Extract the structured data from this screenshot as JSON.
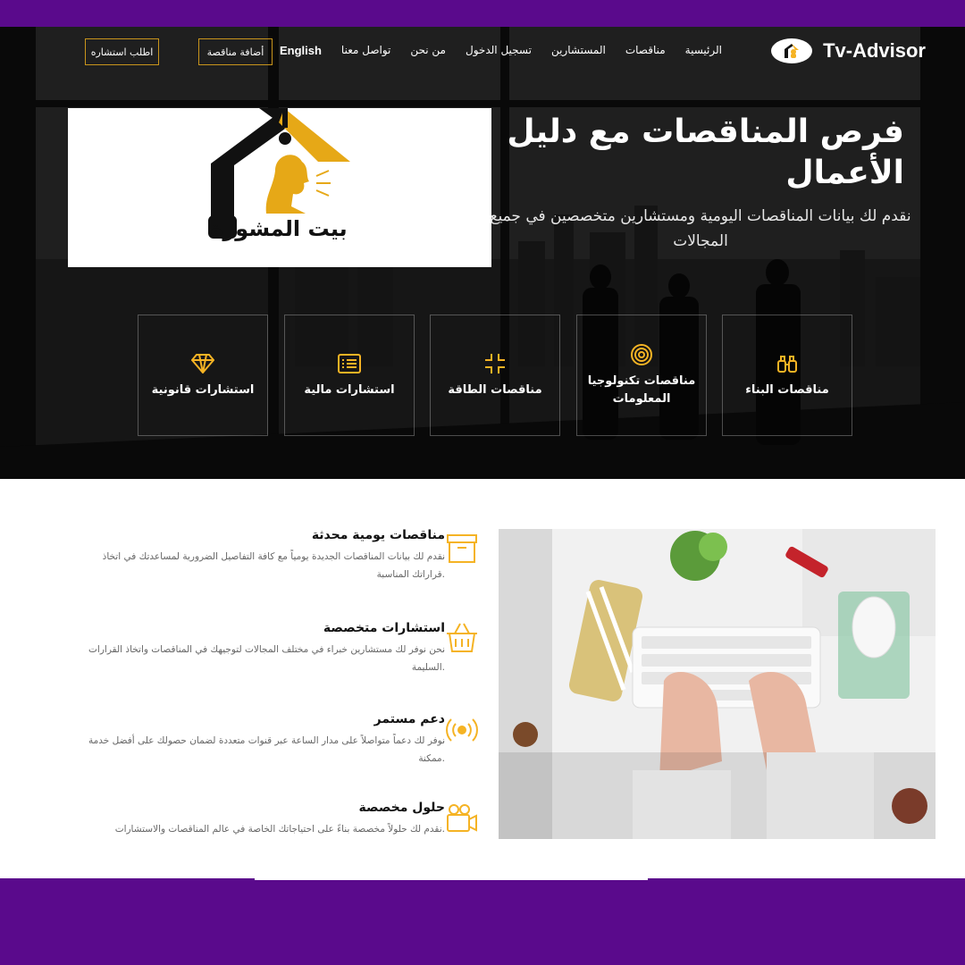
{
  "colors": {
    "accent": "#f5b324",
    "frame": "#5a0a8c",
    "hero_dark": "#1a1a1a"
  },
  "brand": {
    "name": "Tv-Advisor",
    "logo_icon": "advisor-logo-icon"
  },
  "nav": {
    "items": [
      "الرئيسية",
      "مناقصات",
      "المستشارين",
      "تسجيل الدخول",
      "من نحن",
      "تواصل معنا",
      "English"
    ],
    "add_tender": "أضافة مناقصة",
    "request_consult": "اطلب استشاره"
  },
  "hero": {
    "title": "فرص المناقصات مع دليل الأعمال",
    "subtitle": "نقدم لك بيانات المناقصات اليومية ومستشارين متخصصين في جميع المجالات",
    "logo_text": "بيت المشورة"
  },
  "cards": [
    {
      "label": "مناقصات البناء",
      "icon": "binoculars-icon"
    },
    {
      "label": "مناقصات تكنولوجيا المعلومات",
      "icon": "target-icon"
    },
    {
      "label": "مناقصات الطاقة",
      "icon": "compress-icon"
    },
    {
      "label": "استشارات مالية",
      "icon": "list-icon"
    },
    {
      "label": "استشارات قانونية",
      "icon": "diamond-icon"
    }
  ],
  "features": [
    {
      "title": "مناقصات يومية محدثة",
      "desc": "نقدم لك بيانات المناقصات الجديدة يومياً مع كافة التفاصيل الضرورية لمساعدتك في اتخاذ قراراتك المناسبة.",
      "icon": "archive-box-icon"
    },
    {
      "title": "استشارات متخصصة",
      "desc": "نحن نوفر لك مستشارين خبراء في مختلف المجالات لتوجيهك في المناقصات واتخاذ القرارات السليمة.",
      "icon": "basket-icon"
    },
    {
      "title": "دعم مستمر",
      "desc": "نوفر لك دعماً متواصلاً على مدار الساعة عبر قنوات متعددة لضمان حصولك على أفضل خدمة ممكنة.",
      "icon": "broadcast-icon"
    },
    {
      "title": "حلول مخصصة",
      "desc": "نقدم لك حلولاً مخصصة بناءً على احتياجاتك الخاصة في عالم المناقصات والاستشارات.",
      "icon": "video-camera-icon"
    }
  ]
}
